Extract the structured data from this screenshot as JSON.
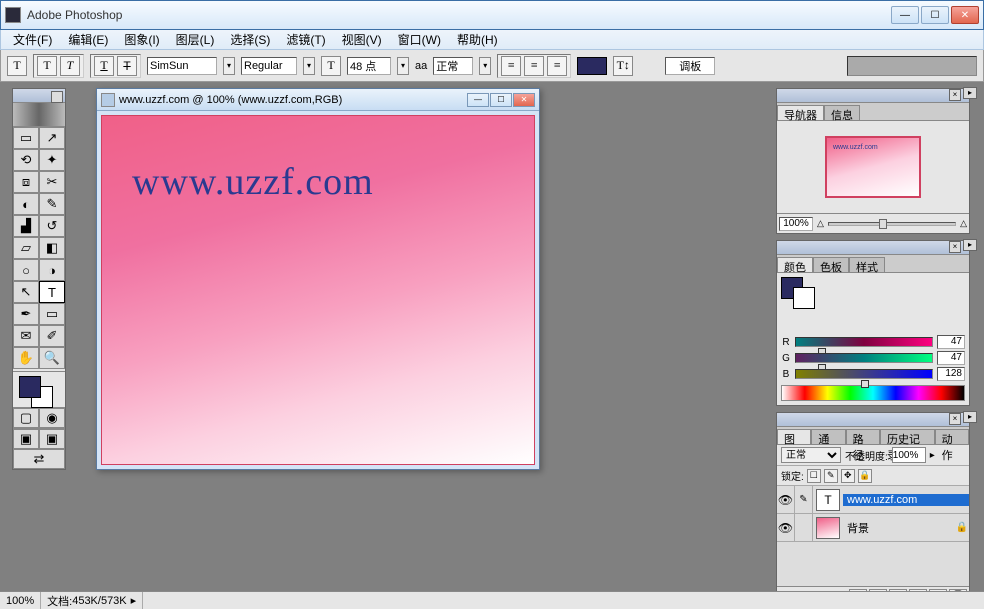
{
  "app": {
    "title": "Adobe Photoshop"
  },
  "menus": [
    "文件(F)",
    "编辑(E)",
    "图象(I)",
    "图层(L)",
    "选择(S)",
    "滤镜(T)",
    "视图(V)",
    "窗口(W)",
    "帮助(H)"
  ],
  "options": {
    "font_family": "SimSun",
    "font_style": "Regular",
    "font_size": "48 点",
    "aa_mode": "正常",
    "palette_btn": "调板"
  },
  "document": {
    "title": "www.uzzf.com @ 100% (www.uzzf.com,RGB)",
    "text_content": "www.uzzf.com"
  },
  "navigator": {
    "tab1": "导航器",
    "tab2": "信息",
    "zoom": "100%",
    "thumb_text": "www.uzzf.com"
  },
  "color": {
    "tab1": "颜色",
    "tab2": "色板",
    "tab3": "样式",
    "r_label": "R",
    "r_value": "47",
    "g_label": "G",
    "g_value": "47",
    "b_label": "B",
    "b_value": "128"
  },
  "layers": {
    "tab1": "图层",
    "tab2": "通道",
    "tab3": "路径",
    "tab4": "历史记录",
    "tab5": "动作",
    "blend_mode": "正常",
    "opacity_label": "不透明度:",
    "opacity_value": "100%",
    "lock_label": "锁定:",
    "layer1_name": "www.uzzf.com",
    "layer2_name": "背景"
  },
  "status": {
    "zoom": "100%",
    "docsize_label": "文档:",
    "docsize": "453K/573K"
  }
}
